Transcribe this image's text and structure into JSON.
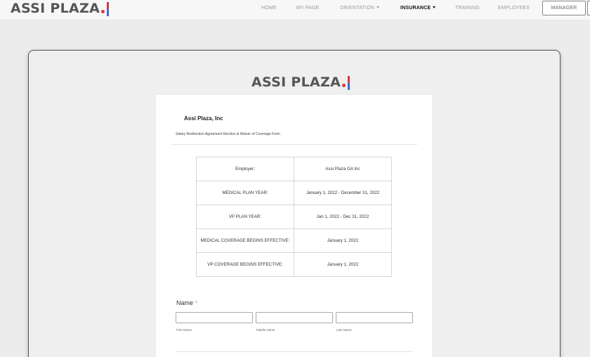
{
  "brand": {
    "name": "ASSI PLAZA"
  },
  "nav": {
    "home": "HOME",
    "my_page": "MY PAGE",
    "orientation": "ORIENTATION",
    "insurance": "INSURANCE",
    "training": "TRAINING",
    "employees": "EMPLOYEES",
    "manager": "MANAGER"
  },
  "form": {
    "company": "Assi Plaza, Inc",
    "subtitle": "Salary Redirection Agreement Election & Waiver of Coverage Form",
    "table": [
      {
        "label": "Employer:",
        "value": "Assi Plaza GA Inc"
      },
      {
        "label": "MEDICAL PLAN YEAR:",
        "value": "January 1, 2022 - December 31, 2022"
      },
      {
        "label": "VP PLAN YEAR:",
        "value": "Jan 1, 2022 - Dec 31, 2022"
      },
      {
        "label": "MEDICAL COVERAGE BEGINS EFFECTIVE:",
        "value": "January 1, 2022"
      },
      {
        "label": "VP COVERAGE BEGINS EFFECTIVE:",
        "value": "January 1, 2022"
      }
    ],
    "name": {
      "label": "Name",
      "required_mark": "*",
      "first_label": "First Name",
      "middle_label": "Middle Name",
      "last_label": "Last Name",
      "first_value": "",
      "middle_value": "",
      "last_value": ""
    }
  },
  "colors": {
    "logo_dot": "#d9383c",
    "logo_bar_top": "#d9383c",
    "logo_bar_bottom": "#3b6fd6",
    "required": "#e04a4a"
  }
}
